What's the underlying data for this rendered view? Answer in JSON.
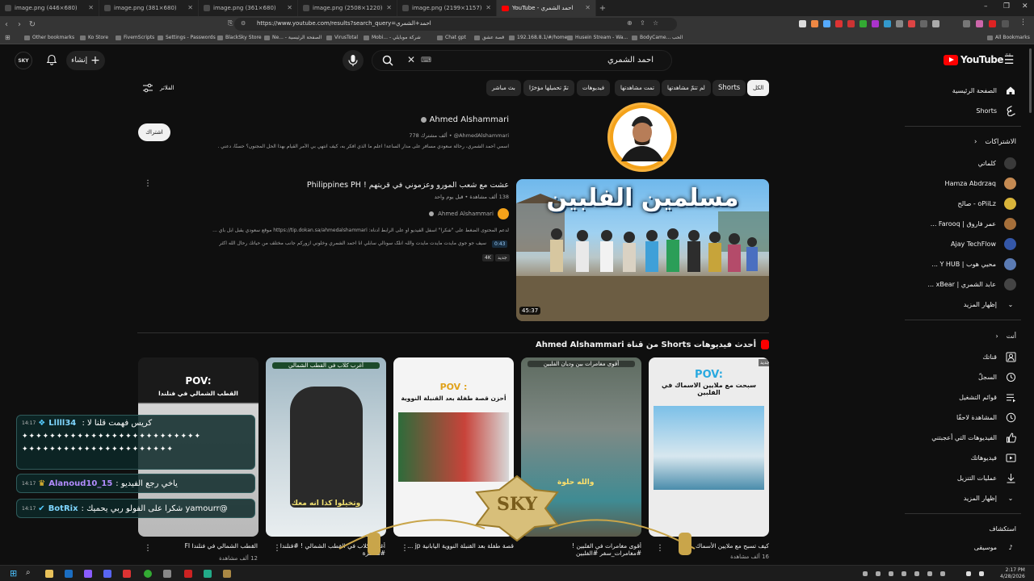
{
  "browser": {
    "tabs": [
      {
        "title": "image.png (446×680)",
        "active": false
      },
      {
        "title": "image.png (381×680)",
        "active": false
      },
      {
        "title": "image.png (361×680)",
        "active": false
      },
      {
        "title": "image.png (2508×1220)",
        "active": false
      },
      {
        "title": "image.png (2199×1157)",
        "active": false
      },
      {
        "title": "YouTube - احمد الشمري",
        "active": true
      }
    ],
    "url": "https://www.youtube.com/results?search_query=احمد+الشمري",
    "bookmarks": [
      "Other bookmarks",
      "Ko Store",
      "FivemScripts",
      "Settings - Passwords",
      "BlackSky Store",
      "Ne... - الصفحة الرئيسية",
      "VirusTotal",
      "Mobi... - شركة موبايلي",
      "Chat gpt",
      "قصة عشق",
      "192.168.8.1/#/home",
      "Husein Stream - Wa...",
      "BodyCame...",
      "الحب"
    ],
    "all_bookmarks": "All Bookmarks"
  },
  "header": {
    "logo": "YouTube",
    "region": "SA",
    "search_value": "احمد الشمري",
    "create_label": "إنشاء",
    "avatar_text": "SKY"
  },
  "sidebar": {
    "home": "الصفحة الرئيسية",
    "shorts": "Shorts",
    "subscriptions_heading": "الاشتراكات",
    "subscriptions": [
      {
        "name": "كلماتي",
        "color": "#3a3a3a"
      },
      {
        "name": "Hamza Abdrzaq",
        "color": "#c58a52"
      },
      {
        "name": "oPiiLz - صالح",
        "color": "#d9b43a"
      },
      {
        "name": "عمر فاروق | Farooq ...",
        "color": "#a56f3a"
      },
      {
        "name": "Ajay TechFlow",
        "color": "#3457a8"
      },
      {
        "name": "محيي هوب | Y HUB ...",
        "color": "#5b7bb3"
      },
      {
        "name": "عابد الشمري | xBear ...",
        "color": "#444"
      }
    ],
    "show_more": "إظهار المزيد",
    "you_heading": "أنت",
    "you_items": [
      {
        "label": "قناتك",
        "icon": "channel-icon"
      },
      {
        "label": "السجلّ",
        "icon": "history-icon"
      },
      {
        "label": "قوائم التشغيل",
        "icon": "playlist-icon"
      },
      {
        "label": "المشاهدة لاحقًا",
        "icon": "clock-icon"
      },
      {
        "label": "الفيديوهات التي أعجبتني",
        "icon": "thumb-up-icon"
      },
      {
        "label": "فيديوهاتك",
        "icon": "video-icon"
      },
      {
        "label": "عمليات التنزيل",
        "icon": "download-icon"
      }
    ],
    "show_more_2": "إظهار المزيد",
    "explore_heading": "استكشاف",
    "music": "موسيقى"
  },
  "filters": {
    "chips": [
      "الكل",
      "Shorts",
      "لم تتمّ مشاهدتها",
      "تمت مشاهدتها",
      "فيديوهات",
      "تمّ تحميلها مؤخرًا",
      "بث مباشر"
    ],
    "filters_label": "الفلاتر"
  },
  "channel": {
    "name": "Ahmed Alshammari",
    "handle": "@AhmedAlshammari",
    "subscribers": "778 ألف مشترك",
    "description": "اسمي أحمد الشمري، رحالة سعودي مسافر على مدار الساعة! اعلم ما الذي افكر به، كيف انتهي بي الأمر القيام بهذا الحل المجنون؟ حسنًا، دعني ...",
    "subscribe_label": "اشتراك"
  },
  "video": {
    "title": "عشت مع شعب المورو وعزموني في قريتهم ! Philippines PH",
    "views": "138 ألف مشاهدة",
    "age": "قبل يوم واحد",
    "channel": "Ahmed Alshammari",
    "desc1": "لدعم المحتوى الضغط على \"شكراً\" اسفل الفيديو او على الرابط أدناه: https://tip.dokan.sa/ahmedalshammari موقع سعودي يقبل ابل باي ...",
    "desc2": "سيف جو جوي مايدت مايدت مايدت واللہ انلک سونالي سابلي انا احمد الشمري وخلوني ازوركم جانب مختلف من حياتك رحال الله اكثر الله",
    "chapter_time": "0:43",
    "badge_new": "جديد",
    "badge_4k": "4K",
    "duration": "45:37",
    "thumb_text": "مسلمين الفلبين"
  },
  "shorts_section": {
    "heading": "أحدث فيديوهات Shorts من قناة Ahmed Alshammari",
    "items": [
      {
        "title": "كيف تسبح مع ملايين الأسماك ...",
        "views": "16 ألف مشاهدة",
        "badge": "جديد",
        "overlay": "POV: سبحت مع ملايين الاسماك في الفلبين",
        "bg": "#e8e8e8"
      },
      {
        "title": "أقوى مغامرات في الفلبين ! #مغامرات_سفر #الفلبين",
        "views": "",
        "overlay": "أقوى مغامرات بين وديان الفلبين",
        "caption": "والله حلوة",
        "bg": "#6a6a60"
      },
      {
        "title": "قصة طفلة بعد القنبلة النووية اليابانية jp ...",
        "views": "",
        "overlay": "POV: أحزن قصة طفلة بعد القنبلة النووية",
        "bg": "#f4f4f4"
      },
      {
        "title": "أغرب كلاب في القطب الشمالي ! #فنلندا #مغامرة",
        "views": "",
        "overlay": "أغرب كلاب في القطب الشمالي",
        "caption": "وتخيلوا كذا انه معك",
        "bg": "#9fb7c3"
      },
      {
        "title": "القطب الشمالي في فنلندا FI",
        "views": "12 ألف مشاهدة",
        "overlay": "POV: القطب الشمالي في فنلندا",
        "bg": "#d8d8d8"
      }
    ]
  },
  "chat": [
    {
      "time": "14:17",
      "user": "Lllll34",
      "msg": "كريس فهمت قلنا لا : ‏‏‏‏‏‏‏‏‏‏‏‏‏‏‏‏‏‏‏‏‏‏‏‏‏‏‏‏‏‏‏‏‏‏‏‏‏",
      "user_color": "#7fd6ff"
    },
    {
      "time": "14:17",
      "user": "Alanoud10_15",
      "msg": "ياخي رجع الفيديو :",
      "user_color": "#b28cff"
    },
    {
      "time": "14:17",
      "user": "BotRix",
      "msg": "@yamourr شكرا على الفولو ربي يحميك :",
      "user_color": "#7fd6ff"
    }
  ],
  "watermark": "SKY",
  "taskbar": {
    "time": "2:17 PM",
    "date": "4/28/2026"
  },
  "colors": {
    "brand_red": "#ff0000",
    "background": "#0f0f0f",
    "chip": "#272727"
  }
}
